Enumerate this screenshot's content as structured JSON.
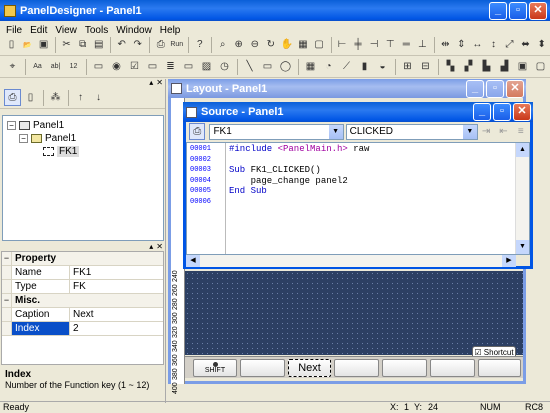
{
  "app": {
    "title": "PanelDesigner - Panel1"
  },
  "menu": [
    "File",
    "Edit",
    "View",
    "Tools",
    "Window",
    "Help"
  ],
  "toolbar1": [
    {
      "icon": "new-icon",
      "g": "▯"
    },
    {
      "icon": "open-icon",
      "g": "📂"
    },
    {
      "icon": "save-icon",
      "g": "▣"
    },
    {
      "sep": 1
    },
    {
      "icon": "cut-icon",
      "g": "✂"
    },
    {
      "icon": "copy-icon",
      "g": "⧉"
    },
    {
      "icon": "paste-icon",
      "g": "▤"
    },
    {
      "sep": 1
    },
    {
      "icon": "undo-icon",
      "g": "↶"
    },
    {
      "icon": "redo-icon",
      "g": "↷"
    },
    {
      "sep": 1
    },
    {
      "icon": "print-icon",
      "g": "⎙"
    },
    {
      "icon": "run-icon",
      "g": "Run"
    },
    {
      "sep": 1
    },
    {
      "icon": "help-icon",
      "g": "?"
    },
    {
      "sep": 1
    },
    {
      "icon": "zoom-icon",
      "g": "⌕"
    },
    {
      "icon": "zoom-in-icon",
      "g": "⊕"
    },
    {
      "icon": "zoom-out-icon",
      "g": "⊖"
    },
    {
      "icon": "rotate-icon",
      "g": "↻"
    },
    {
      "icon": "hand-icon",
      "g": "✋"
    },
    {
      "icon": "grid-icon",
      "g": "▦"
    },
    {
      "icon": "frame-icon",
      "g": "▢"
    },
    {
      "sep": 1
    },
    {
      "icon": "align-left-icon",
      "g": "⊢"
    },
    {
      "icon": "align-center-icon",
      "g": "╪"
    },
    {
      "icon": "align-right-icon",
      "g": "⊣"
    },
    {
      "icon": "align-top-icon",
      "g": "⊤"
    },
    {
      "icon": "align-middle-icon",
      "g": "═"
    },
    {
      "icon": "align-bottom-icon",
      "g": "⊥"
    },
    {
      "sep": 1
    },
    {
      "icon": "space-h-icon",
      "g": "⇹"
    },
    {
      "icon": "space-v-icon",
      "g": "⇕"
    },
    {
      "icon": "same-width-icon",
      "g": "↔"
    },
    {
      "icon": "same-height-icon",
      "g": "↕"
    },
    {
      "icon": "same-size-icon",
      "g": "⤢"
    },
    {
      "icon": "center-h-icon",
      "g": "⬌"
    },
    {
      "icon": "center-v-icon",
      "g": "⬍"
    }
  ],
  "toolbar2": [
    {
      "icon": "select-icon",
      "g": "⌖"
    },
    {
      "sep": 1
    },
    {
      "icon": "text-icon",
      "g": "Aa"
    },
    {
      "icon": "label-icon",
      "g": "ab|"
    },
    {
      "icon": "number-icon",
      "g": "12"
    },
    {
      "sep": 1
    },
    {
      "icon": "button-icon",
      "g": "▭"
    },
    {
      "icon": "radio-icon",
      "g": "◉"
    },
    {
      "icon": "check-icon",
      "g": "☑"
    },
    {
      "icon": "combo-icon",
      "g": "▭"
    },
    {
      "icon": "list-icon",
      "g": "≣"
    },
    {
      "icon": "edit-icon",
      "g": "▭"
    },
    {
      "icon": "image-icon",
      "g": "▨"
    },
    {
      "icon": "timer-icon",
      "g": "◷"
    },
    {
      "sep": 1
    },
    {
      "icon": "line-icon",
      "g": "╲"
    },
    {
      "icon": "rect-icon",
      "g": "▭"
    },
    {
      "icon": "ellipse-icon",
      "g": "◯"
    },
    {
      "sep": 1
    },
    {
      "icon": "table-icon",
      "g": "▦"
    },
    {
      "icon": "meter-icon",
      "g": "◔"
    },
    {
      "icon": "trend-icon",
      "g": "⟋"
    },
    {
      "icon": "bar-icon",
      "g": "▮"
    },
    {
      "icon": "gauge-icon",
      "g": "◒"
    },
    {
      "sep": 1
    },
    {
      "icon": "group-icon",
      "g": "⊞"
    },
    {
      "icon": "ungroup-icon",
      "g": "⊟"
    },
    {
      "sep": 1
    },
    {
      "icon": "front-icon",
      "g": "▚"
    },
    {
      "icon": "back-icon",
      "g": "▞"
    },
    {
      "icon": "forward-icon",
      "g": "▙"
    },
    {
      "icon": "backward-icon",
      "g": "▟"
    },
    {
      "icon": "lock-icon",
      "g": "▣"
    },
    {
      "icon": "unlock-icon",
      "g": "▢"
    }
  ],
  "tree": {
    "root": "Panel1",
    "child": "Panel1",
    "leaf": "FK1"
  },
  "properties": {
    "groups": [
      {
        "name": "Property",
        "rows": [
          {
            "k": "Name",
            "v": "FK1"
          },
          {
            "k": "Type",
            "v": "FK"
          }
        ]
      },
      {
        "name": "Misc.",
        "rows": [
          {
            "k": "Caption",
            "v": "Next"
          },
          {
            "k": "Index",
            "v": "2"
          }
        ]
      }
    ],
    "desc_title": "Index",
    "desc_text": "Number of the Function key (1 ~ 12)"
  },
  "layout": {
    "title": "Layout - Panel1",
    "ruler": [
      "240",
      "260",
      "280",
      "300",
      "320",
      "340",
      "360",
      "380",
      "400"
    ],
    "fkeys": {
      "shift": "SHIFT",
      "next": "Next"
    },
    "shortcut": "Shortcut"
  },
  "source": {
    "title": "Source - Panel1",
    "object": "FK1",
    "event": "CLICKED",
    "line_numbers": [
      "00001",
      "00002",
      "00003",
      "00004",
      "00005",
      "00006"
    ],
    "lines": [
      [
        {
          "t": "#include ",
          "c": "kw"
        },
        {
          "t": "<PanelMain.h>",
          "c": "str"
        },
        {
          "t": " raw",
          "c": "txt"
        }
      ],
      [],
      [
        {
          "t": "Sub ",
          "c": "kw"
        },
        {
          "t": "FK1_CLICKED()",
          "c": "txt"
        }
      ],
      [
        {
          "t": "    page_change panel2",
          "c": "txt"
        }
      ],
      [
        {
          "t": "End Sub",
          "c": "kw"
        }
      ],
      []
    ]
  },
  "status": {
    "text": "Ready",
    "x": "X:",
    "x_val": "1",
    "y": "Y:",
    "y_val": "24",
    "num": "NUM",
    "rc": "RC8"
  },
  "colors": {
    "kw": "#0000c8",
    "str": "#a000a0",
    "txt": "#000000",
    "linenum": "#0000ff",
    "selected": "#0a4fc8"
  }
}
